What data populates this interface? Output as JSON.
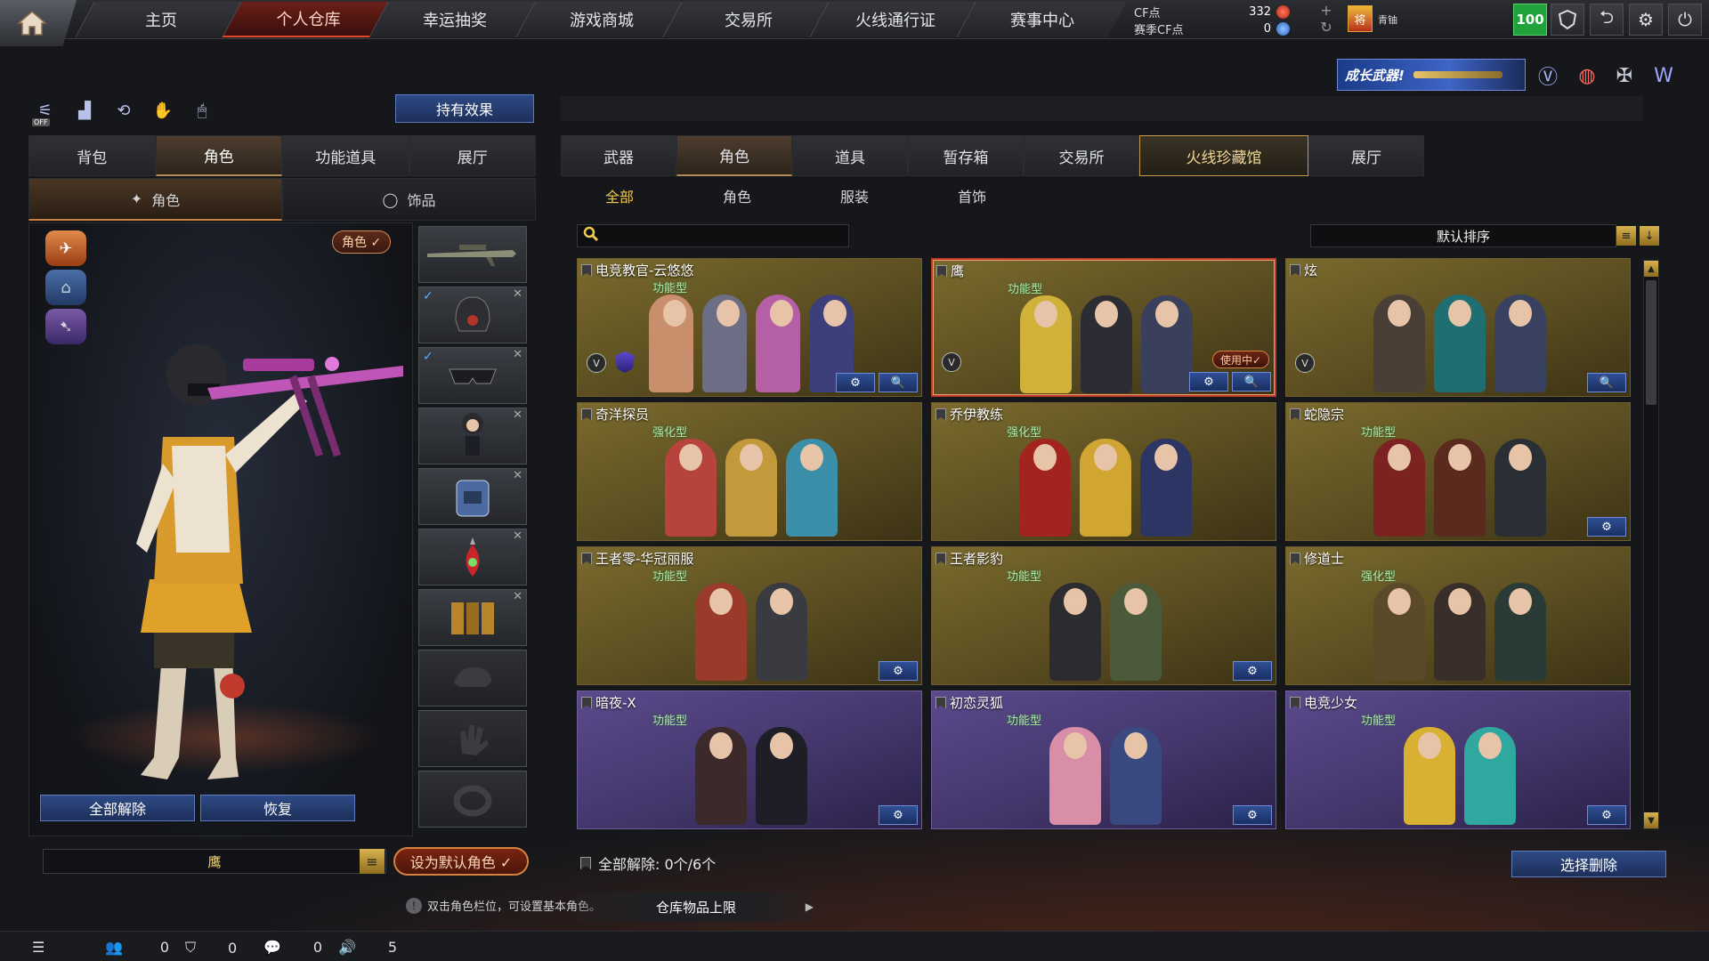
{
  "nav": {
    "tabs": [
      {
        "label": "主页",
        "active": false
      },
      {
        "label": "个人仓库",
        "active": true
      },
      {
        "label": "幸运抽奖",
        "active": false
      },
      {
        "label": "游戏商城",
        "active": false
      },
      {
        "label": "交易所",
        "active": false
      },
      {
        "label": "火线通行证",
        "active": false
      },
      {
        "label": "赛事中心",
        "active": false
      }
    ]
  },
  "currency": {
    "cf_label": "CF点",
    "cf_value": "332",
    "season_label": "赛季CF点",
    "season_value": "0"
  },
  "user": {
    "rank_glyph": "将",
    "name": "青铀",
    "level": "100"
  },
  "promo": {
    "label": "成长武器!"
  },
  "left": {
    "hold_effect_label": "持有效果",
    "tool_icon_names": [
      "voice-off-icon",
      "podium-icon",
      "rotate-icon",
      "pose-icon",
      "mouse-icon"
    ],
    "off_tag": "OFF",
    "tabs": [
      {
        "label": "背包",
        "active": false
      },
      {
        "label": "角色",
        "active": true
      },
      {
        "label": "功能道具",
        "active": false
      },
      {
        "label": "展厅",
        "active": false
      }
    ],
    "sub_tabs": [
      {
        "label": "角色",
        "active": true
      },
      {
        "label": "饰品",
        "active": false
      }
    ],
    "role_pill": "角色 ✓",
    "release_all_label": "全部解除",
    "restore_label": "恢复",
    "current_name": "鹰",
    "set_default_label": "设为默认角色 ✓",
    "hint": "双击角色栏位，可设置基本角色。",
    "hint_icon": "!"
  },
  "right": {
    "main_tabs": [
      {
        "label": "武器",
        "active": false
      },
      {
        "label": "角色",
        "active": true
      },
      {
        "label": "道具",
        "active": false
      },
      {
        "label": "暂存箱",
        "active": false
      },
      {
        "label": "交易所",
        "active": false
      },
      {
        "label": "火线珍藏馆",
        "active": false,
        "special": true
      },
      {
        "label": "展厅",
        "active": false
      }
    ],
    "filters": [
      {
        "label": "全部",
        "active": true
      },
      {
        "label": "角色",
        "active": false
      },
      {
        "label": "服装",
        "active": false
      },
      {
        "label": "首饰",
        "active": false
      }
    ],
    "search_placeholder": "",
    "sort_label": "默认排序",
    "release_summary": "全部解除:  0个/6个",
    "select_delete_label": "选择删除",
    "storage_label": "仓库物品上限",
    "cards": [
      {
        "title": "电竞教官-云悠悠",
        "type": "功能型",
        "theme": "gold",
        "figures": 4,
        "colors": [
          "#c98f6d",
          "#6c6e85",
          "#b55fa6",
          "#3c3f7a"
        ],
        "v": true,
        "shield": true,
        "btns": [
          "⚙",
          "🔍"
        ],
        "selected": false,
        "inuse": ""
      },
      {
        "title": "鹰",
        "type": "功能型",
        "theme": "gold",
        "figures": 3,
        "colors": [
          "#d0b23a",
          "#2c2c34",
          "#3a3f5c"
        ],
        "v": true,
        "shield": false,
        "btns": [
          "⚙",
          "🔍"
        ],
        "selected": true,
        "inuse": "使用中✓"
      },
      {
        "title": "炫",
        "type": "",
        "theme": "gold",
        "figures": 3,
        "colors": [
          "#4a3f36",
          "#1f6e72",
          "#394160"
        ],
        "v": true,
        "shield": false,
        "btns": [
          "🔍"
        ],
        "selected": false,
        "inuse": ""
      },
      {
        "title": "奇洋探员",
        "type": "强化型",
        "theme": "gold",
        "figures": 3,
        "colors": [
          "#b6443c",
          "#c39a3b",
          "#3b8fa8"
        ],
        "v": false,
        "shield": false,
        "btns": [],
        "selected": false,
        "inuse": ""
      },
      {
        "title": "乔伊教练",
        "type": "强化型",
        "theme": "gold",
        "figures": 3,
        "colors": [
          "#a3231f",
          "#d0a532",
          "#2d3564"
        ],
        "v": false,
        "shield": false,
        "btns": [],
        "selected": false,
        "inuse": ""
      },
      {
        "title": "蛇隐宗",
        "type": "功能型",
        "theme": "gold",
        "figures": 3,
        "colors": [
          "#7a2320",
          "#5a2a1e",
          "#2a2f36"
        ],
        "v": false,
        "shield": false,
        "btns": [
          "⚙"
        ],
        "selected": false,
        "inuse": ""
      },
      {
        "title": "王者零-华冠丽服",
        "type": "功能型",
        "theme": "gold",
        "figures": 2,
        "colors": [
          "#9a3a2a",
          "#3a3b40"
        ],
        "v": false,
        "shield": false,
        "btns": [
          "⚙"
        ],
        "selected": false,
        "inuse": ""
      },
      {
        "title": "王者影豹",
        "type": "功能型",
        "theme": "gold",
        "figures": 2,
        "colors": [
          "#2b2b30",
          "#4a5a3a"
        ],
        "v": false,
        "shield": false,
        "btns": [
          "⚙"
        ],
        "selected": false,
        "inuse": ""
      },
      {
        "title": "修道士",
        "type": "强化型",
        "theme": "gold",
        "figures": 3,
        "colors": [
          "#5a4a2a",
          "#3a2e2a",
          "#2a3a34"
        ],
        "v": false,
        "shield": false,
        "btns": [],
        "selected": false,
        "inuse": ""
      },
      {
        "title": "暗夜-X",
        "type": "功能型",
        "theme": "purple",
        "figures": 2,
        "colors": [
          "#3c2a2a",
          "#1e1e26"
        ],
        "v": false,
        "shield": false,
        "btns": [
          "⚙"
        ],
        "selected": false,
        "inuse": ""
      },
      {
        "title": "初恋灵狐",
        "type": "功能型",
        "theme": "purple",
        "figures": 2,
        "colors": [
          "#d78ea6",
          "#3a4a80"
        ],
        "v": false,
        "shield": false,
        "btns": [
          "⚙"
        ],
        "selected": false,
        "inuse": ""
      },
      {
        "title": "电竞少女",
        "type": "功能型",
        "theme": "purple",
        "figures": 2,
        "colors": [
          "#d8b032",
          "#2fa8a0"
        ],
        "v": false,
        "shield": false,
        "btns": [
          "⚙"
        ],
        "selected": false,
        "inuse": ""
      }
    ]
  },
  "bottom": {
    "count1": "0",
    "count2": "0",
    "count3": "0",
    "count4": "5"
  }
}
